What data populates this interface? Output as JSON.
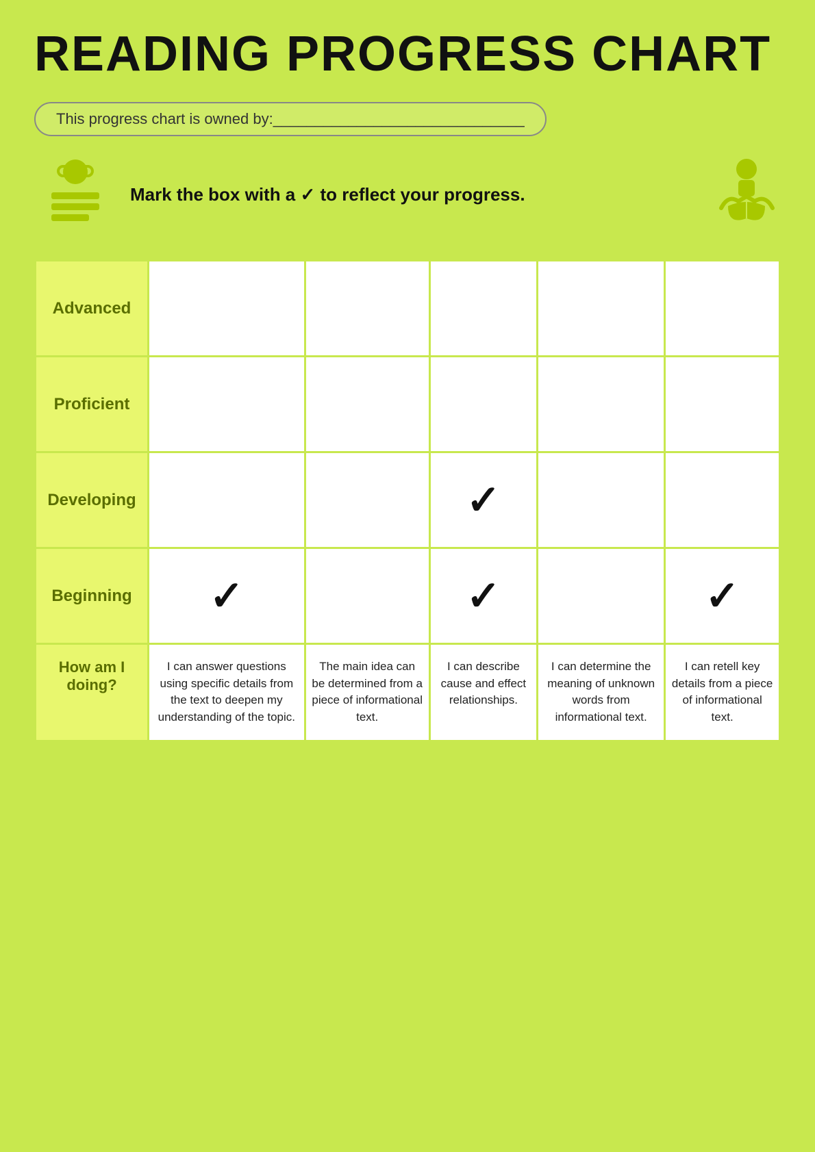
{
  "title": "READING PROGRESS CHART",
  "owner_label": "This progress chart is owned by:______________________________",
  "instruction": "Mark the box with a ✓ to reflect your progress.",
  "rows": [
    {
      "id": "advanced",
      "label": "Advanced"
    },
    {
      "id": "proficient",
      "label": "Proficient"
    },
    {
      "id": "developing",
      "label": "Developing"
    },
    {
      "id": "beginning",
      "label": "Beginning"
    }
  ],
  "how_label": "How am I doing?",
  "descriptions": [
    "I can answer questions using specific details from the text to deepen my understanding of the topic.",
    "The main idea can be determined from a piece of informational text.",
    "I can describe cause and effect relationships.",
    "I can determine the meaning of unknown words from informational text.",
    "I can retell key details from a piece of informational text."
  ],
  "checkmarks": {
    "developing_col3": "✓",
    "beginning_col1": "✓",
    "beginning_col3": "✓",
    "beginning_col5": "✓"
  },
  "colors": {
    "bg": "#c8e84e",
    "label_cell": "#e8f76e",
    "label_text": "#5a6e00",
    "border": "#c8e84e"
  }
}
